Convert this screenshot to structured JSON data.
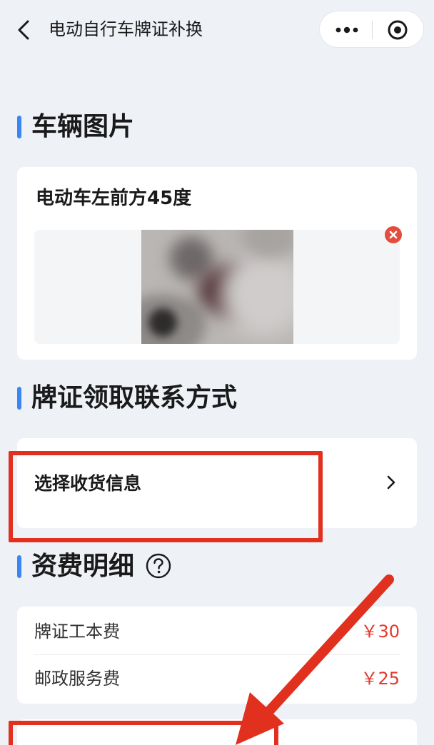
{
  "header": {
    "title": "电动自行车牌证补换",
    "back_icon": "chevron-left-icon",
    "more_icon": "more-dots-icon",
    "close_icon": "target-circle-icon"
  },
  "vehicle_photos": {
    "section_title": "车辆图片",
    "photo_label": "电动车左前方45度",
    "delete_icon": "close-icon"
  },
  "contact": {
    "section_title": "牌证领取联系方式",
    "select_label": "选择收货信息",
    "chevron_icon": "chevron-right-icon"
  },
  "fees": {
    "section_title": "资费明细",
    "help_icon": "question-circle-icon",
    "items": [
      {
        "label": "牌证工本费",
        "price": "￥30"
      },
      {
        "label": "邮政服务费",
        "price": "￥25"
      }
    ]
  },
  "colors": {
    "accent": "#3a86f5",
    "price": "#e23a2c",
    "annotation": "#e2301f",
    "background": "#eef1f6"
  }
}
